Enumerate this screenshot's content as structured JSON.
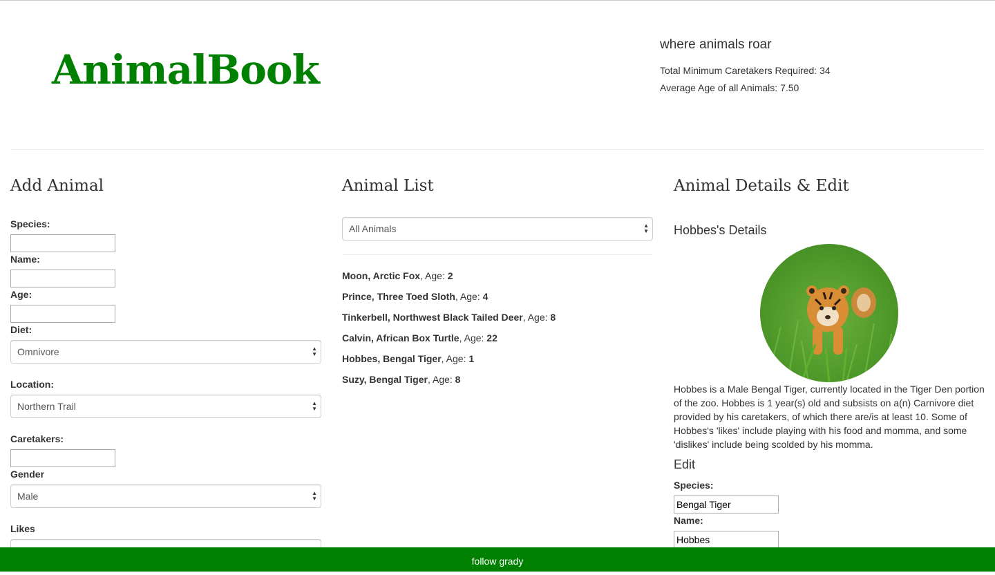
{
  "header": {
    "logo": "AnimalBook",
    "tagline": "where animals roar",
    "stat_caretakers": "Total Minimum Caretakers Required: 34",
    "stat_age": "Average Age of all Animals: 7.50"
  },
  "colors": {
    "brand": "#008000"
  },
  "add_animal": {
    "title": "Add Animal",
    "species_label": "Species:",
    "species_value": "",
    "name_label": "Name:",
    "name_value": "",
    "age_label": "Age:",
    "age_value": "",
    "diet_label": "Diet:",
    "diet_value": "Omnivore",
    "location_label": "Location:",
    "location_value": "Northern Trail",
    "caretakers_label": "Caretakers:",
    "caretakers_value": "",
    "gender_label": "Gender",
    "gender_value": "Male",
    "likes_label": "Likes"
  },
  "animal_list": {
    "title": "Animal List",
    "filter_value": "All Animals",
    "age_prefix": ", Age: ",
    "items": [
      {
        "name_species": "Moon, Arctic Fox",
        "age": "2"
      },
      {
        "name_species": "Prince, Three Toed Sloth",
        "age": "4"
      },
      {
        "name_species": "Tinkerbell, Northwest Black Tailed Deer",
        "age": "8"
      },
      {
        "name_species": "Calvin, African Box Turtle",
        "age": "22"
      },
      {
        "name_species": "Hobbes, Bengal Tiger",
        "age": "1"
      },
      {
        "name_species": "Suzy, Bengal Tiger",
        "age": "8"
      }
    ]
  },
  "details": {
    "title": "Animal Details & Edit",
    "heading": "Hobbes's Details",
    "photo_icon": "tiger-cub-photo",
    "description": "Hobbes is a Male Bengal Tiger, currently located in the Tiger Den portion of the zoo. Hobbes is 1 year(s) old and subsists on a(n) Carnivore diet provided by his caretakers, of which there are/is at least 10. Some of Hobbes's 'likes' include playing with his food and momma, and some 'dislikes' include being scolded by his momma.",
    "edit_heading": "Edit",
    "species_label": "Species:",
    "species_value": "Bengal Tiger",
    "name_label": "Name:",
    "name_value": "Hobbes"
  },
  "footer": {
    "text": "follow grady"
  }
}
